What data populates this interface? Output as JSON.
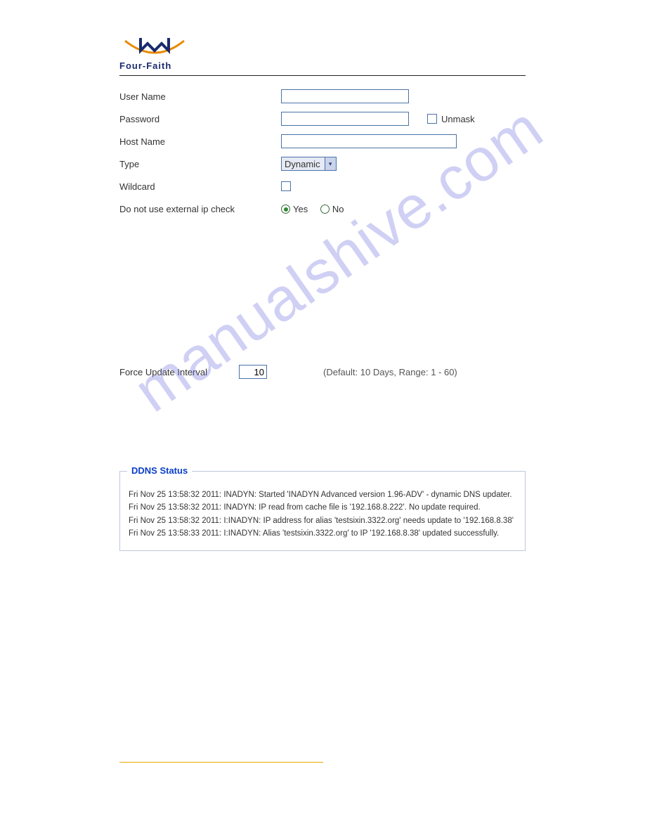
{
  "logo": {
    "brand": "Four-Faith"
  },
  "form": {
    "username_label": "User Name",
    "username_value": "",
    "password_label": "Password",
    "password_value": "",
    "unmask_label": "Unmask",
    "hostname_label": "Host Name",
    "hostname_value": "",
    "type_label": "Type",
    "type_value": "Dynamic",
    "wildcard_label": "Wildcard",
    "ext_ip_label": "Do not use external ip check",
    "yes": "Yes",
    "no": "No",
    "force_label": "Force Update Interval",
    "force_value": "10",
    "force_note": "(Default: 10 Days, Range: 1 - 60)"
  },
  "status": {
    "title": "DDNS Status",
    "lines": [
      "Fri Nov 25 13:58:32 2011: INADYN: Started 'INADYN Advanced version 1.96-ADV' - dynamic DNS updater.",
      "Fri Nov 25 13:58:32 2011: INADYN: IP read from cache file is '192.168.8.222'. No update required.",
      "Fri Nov 25 13:58:32 2011: I:INADYN: IP address for alias 'testsixin.3322.org' needs update to '192.168.8.38'",
      "Fri Nov 25 13:58:33 2011: I:INADYN: Alias 'testsixin.3322.org' to IP '192.168.8.38' updated successfully."
    ]
  },
  "watermark": "manualshive.com"
}
